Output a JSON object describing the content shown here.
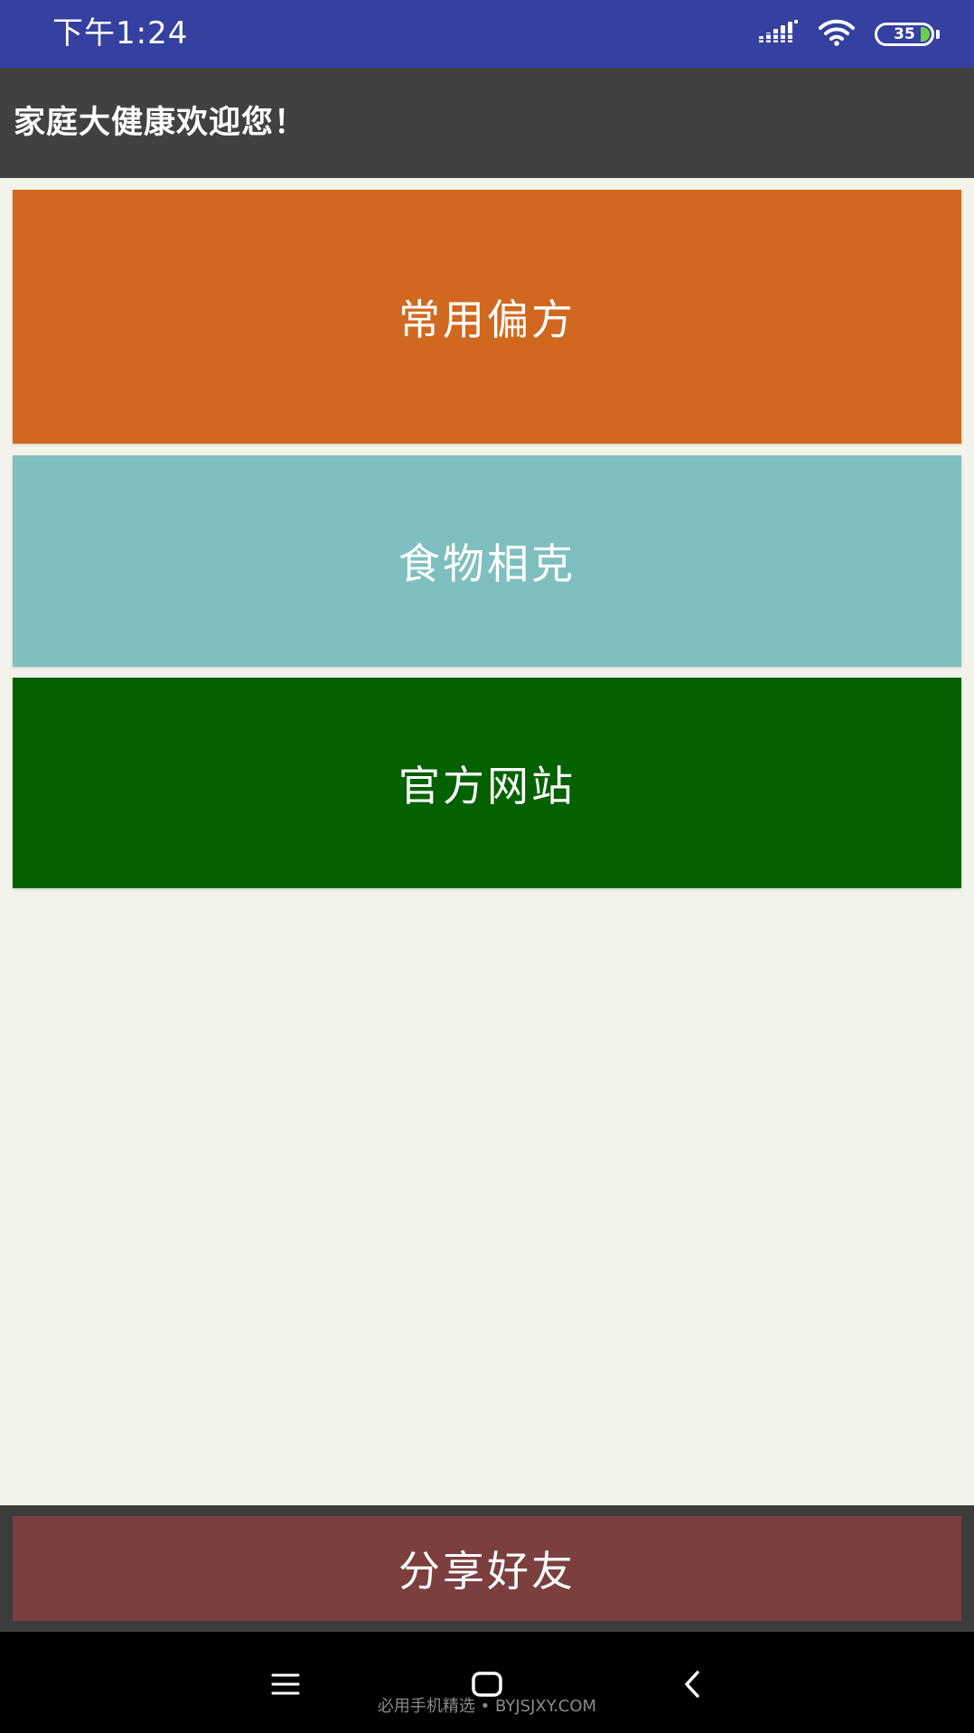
{
  "status_bar": {
    "time": "下午1:24",
    "battery_level": "35",
    "icons": [
      "signal-icon",
      "wifi-icon",
      "battery-icon"
    ],
    "background_color": "#3540a0"
  },
  "app_bar": {
    "title": "家庭大健康欢迎您！",
    "background_color": "#414141"
  },
  "menu": {
    "items": [
      {
        "label": "常用偏方",
        "color": "#d0691f"
      },
      {
        "label": "食物相克",
        "color": "#80bfbf"
      },
      {
        "label": "官方网站",
        "color": "#036100"
      }
    ]
  },
  "share": {
    "label": "分享好友",
    "color": "#7c3f40"
  },
  "nav_bar": {
    "buttons": [
      "menu-icon",
      "home-icon",
      "back-icon"
    ]
  },
  "watermark": "必用手机精选 • BYJSJXY.COM"
}
